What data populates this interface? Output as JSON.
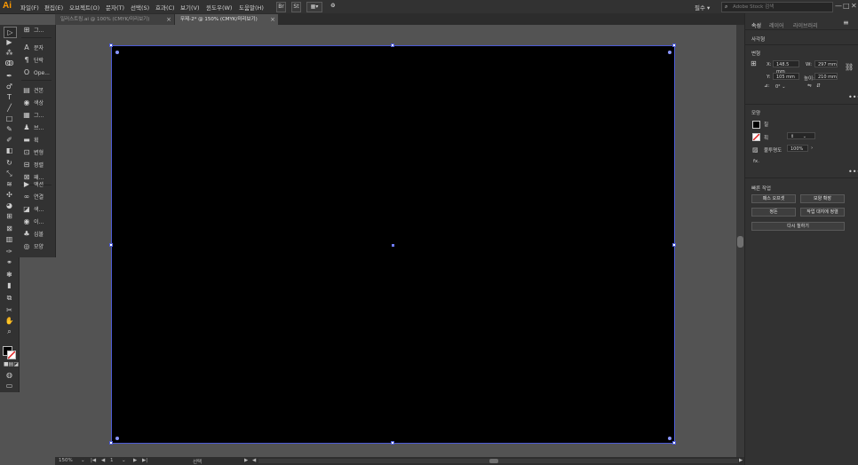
{
  "app": {
    "logo": "Ai"
  },
  "menu": [
    "파일(F)",
    "편집(E)",
    "오브젝트(O)",
    "문자(T)",
    "선택(S)",
    "효과(C)",
    "보기(V)",
    "윈도우(W)",
    "도움말(H)"
  ],
  "menubar": {
    "br_label": "Br",
    "st_label": "St",
    "workspace": "필수",
    "workspace_chevron": "▾",
    "search_placeholder": "Adobe Stock 검색",
    "minimize": "—",
    "maximize": "□",
    "close": "✕"
  },
  "tabs": [
    {
      "label": "일러스트링.ai @ 100% (CMYK/미리보기)",
      "close": "×"
    },
    {
      "label": "무제-2* @ 150% (CMYK/미리보기)",
      "close": "×"
    }
  ],
  "strip_panels": [
    {
      "icon": "⊞",
      "label": "그..."
    },
    {
      "icon": "A",
      "label": "문자"
    },
    {
      "icon": "¶",
      "label": "단락"
    },
    {
      "icon": "O",
      "label": "Ope..."
    },
    {
      "icon": "▤",
      "label": "견본"
    },
    {
      "icon": "◉",
      "label": "색상"
    },
    {
      "icon": "▦",
      "label": "그..."
    },
    {
      "icon": "♟",
      "label": "브..."
    },
    {
      "icon": "▬",
      "label": "획"
    },
    {
      "icon": "⊡",
      "label": "변형"
    },
    {
      "icon": "⊟",
      "label": "정렬"
    },
    {
      "icon": "⊠",
      "label": "패..."
    },
    {
      "icon": "▶",
      "label": "액션"
    },
    {
      "icon": "∞",
      "label": "연결"
    },
    {
      "icon": "◪",
      "label": "색..."
    },
    {
      "icon": "◉",
      "label": "이..."
    },
    {
      "icon": "♣",
      "label": "심볼"
    },
    {
      "icon": "◎",
      "label": "모양"
    }
  ],
  "properties": {
    "tabs": [
      "속성",
      "레이어",
      "라이브러리"
    ],
    "object_type": "사각형",
    "transform_title": "변형",
    "x_label": "X:",
    "x_value": "148.5 mm",
    "y_label": "Y:",
    "y_value": "105 mm",
    "w_label": "W:",
    "w_value": "297 mm",
    "h_label": "높이:",
    "h_value": "210 mm",
    "angle_value": "0°",
    "appearance_title": "모양",
    "fill_label": "칠",
    "stroke_label": "획",
    "opacity_label": "불투명도",
    "opacity_value": "100%",
    "fx_label": "fx.",
    "quick_actions_title": "빠른 작업",
    "buttons": [
      "패스 오프셋",
      "모양 확장",
      "정돈",
      "작업 대지에 정렬",
      "다시 칠하기"
    ]
  },
  "status": {
    "zoom": "150%",
    "page": "1",
    "mode": "선택"
  }
}
